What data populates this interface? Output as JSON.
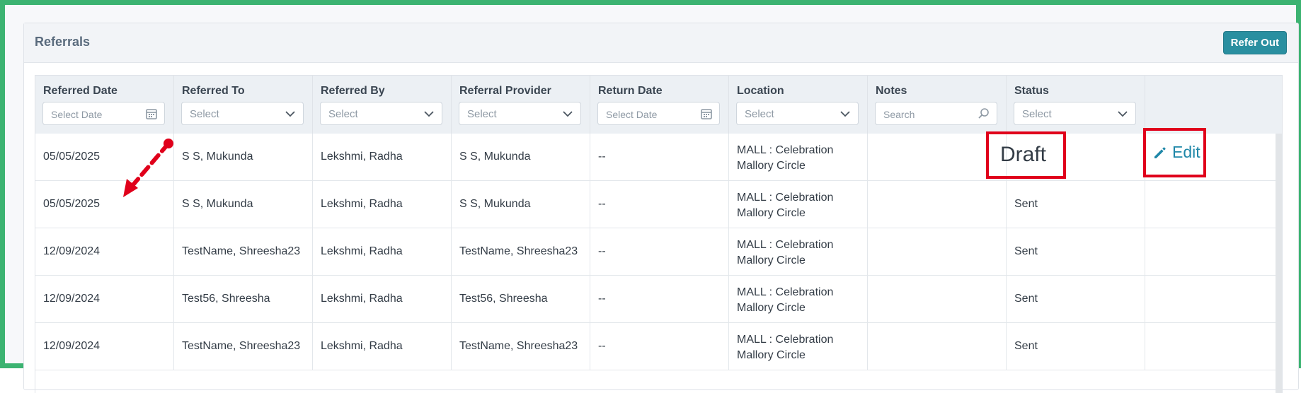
{
  "panel": {
    "title": "Referrals",
    "refer_out_label": "Refer Out"
  },
  "columns": [
    {
      "key": "referred_date",
      "label": "Referred Date",
      "filter": "Select Date",
      "filter_type": "date"
    },
    {
      "key": "referred_to",
      "label": "Referred To",
      "filter": "Select",
      "filter_type": "select"
    },
    {
      "key": "referred_by",
      "label": "Referred By",
      "filter": "Select",
      "filter_type": "select"
    },
    {
      "key": "referral_provider",
      "label": "Referral Provider",
      "filter": "Select",
      "filter_type": "select"
    },
    {
      "key": "return_date",
      "label": "Return Date",
      "filter": "Select Date",
      "filter_type": "date"
    },
    {
      "key": "location",
      "label": "Location",
      "filter": "Select",
      "filter_type": "select"
    },
    {
      "key": "notes",
      "label": "Notes",
      "filter": "Search",
      "filter_type": "search"
    },
    {
      "key": "status",
      "label": "Status",
      "filter": "Select",
      "filter_type": "select"
    },
    {
      "key": "actions",
      "label": "",
      "filter": "",
      "filter_type": "none"
    }
  ],
  "rows": [
    {
      "referred_date": "05/05/2025",
      "referred_to": "S S, Mukunda",
      "referred_by": "Lekshmi, Radha",
      "referral_provider": "S S, Mukunda",
      "return_date": "--",
      "location": "MALL : Celebration Mallory Circle",
      "notes": "",
      "status": "Draft",
      "action": "Edit"
    },
    {
      "referred_date": "05/05/2025",
      "referred_to": "S S, Mukunda",
      "referred_by": "Lekshmi, Radha",
      "referral_provider": "S S, Mukunda",
      "return_date": "--",
      "location": "MALL : Celebration Mallory Circle",
      "notes": "",
      "status": "Sent",
      "action": ""
    },
    {
      "referred_date": "12/09/2024",
      "referred_to": "TestName, Shreesha23",
      "referred_by": "Lekshmi, Radha",
      "referral_provider": "TestName, Shreesha23",
      "return_date": "--",
      "location": "MALL : Celebration Mallory Circle",
      "notes": "",
      "status": "Sent",
      "action": ""
    },
    {
      "referred_date": "12/09/2024",
      "referred_to": "Test56, Shreesha",
      "referred_by": "Lekshmi, Radha",
      "referral_provider": "Test56, Shreesha",
      "return_date": "--",
      "location": "MALL : Celebration Mallory Circle",
      "notes": "",
      "status": "Sent",
      "action": ""
    },
    {
      "referred_date": "12/09/2024",
      "referred_to": "TestName, Shreesha23",
      "referred_by": "Lekshmi, Radha",
      "referral_provider": "TestName, Shreesha23",
      "return_date": "--",
      "location": "MALL : Celebration Mallory Circle",
      "notes": "",
      "status": "Sent",
      "action": ""
    }
  ],
  "colors": {
    "frame_border": "#3cb371",
    "primary_button": "#2a8fa0",
    "link": "#1f87a8",
    "annotation_red": "#e0001b"
  },
  "icons": {
    "date_filter": "calendar-icon",
    "select_filter": "chevron-down-icon",
    "search_filter": "search-icon",
    "edit": "pencil-icon"
  }
}
